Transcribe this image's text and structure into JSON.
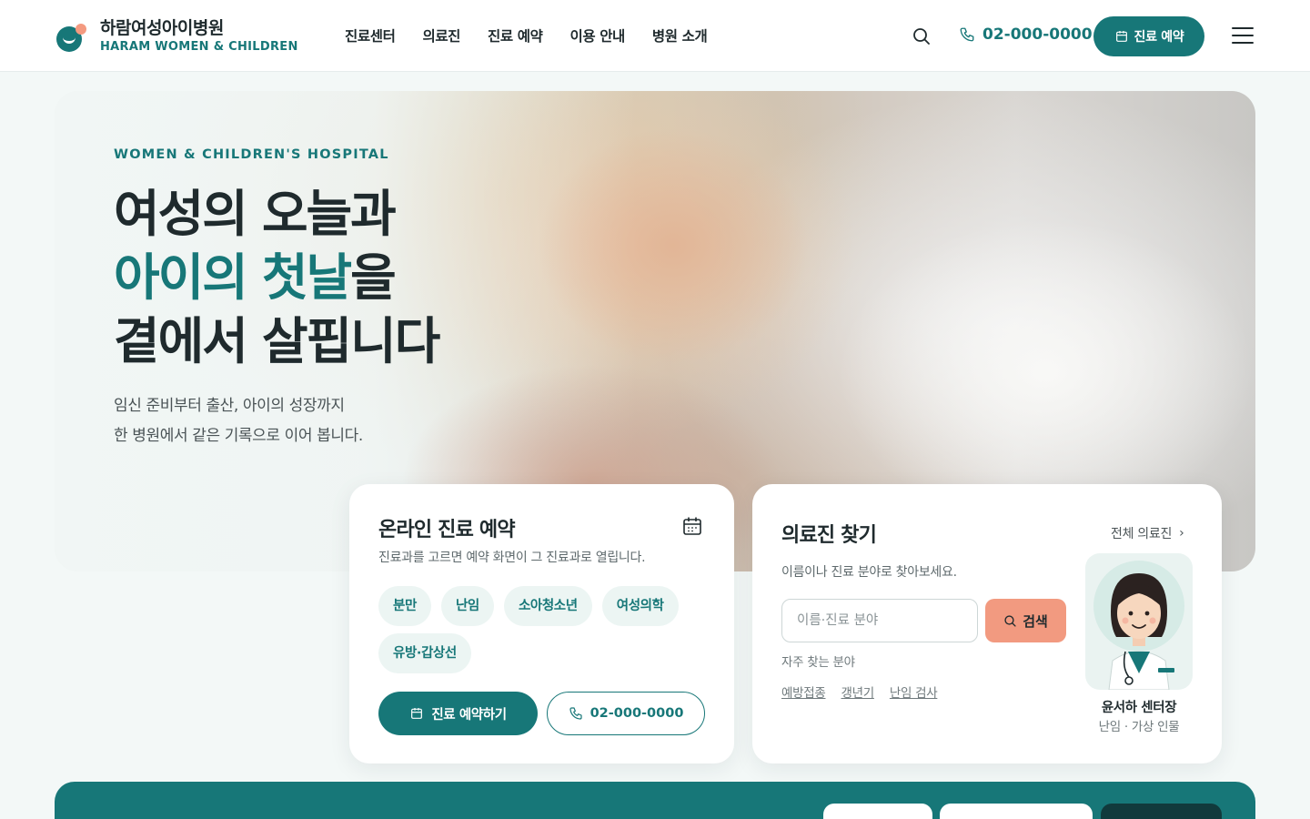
{
  "brand": {
    "name_ko": "하람여성아이병원",
    "name_en": "HARAM WOMEN & CHILDREN",
    "accent": "#177778",
    "coral": "#f29a80"
  },
  "nav": [
    "진료센터",
    "의료진",
    "진료 예약",
    "이용 안내",
    "병원 소개"
  ],
  "header": {
    "phone": "02-000-0000",
    "reserve_label": "진료 예약"
  },
  "hero": {
    "eyebrow": "WOMEN & CHILDREN'S HOSPITAL",
    "title_line1": "여성의 오늘과",
    "title_accent": "아이의 첫날",
    "title_line2_rest": "을",
    "title_line3": "곁에서 살핍니다",
    "sub_line1": "임신 준비부터 출산, 아이의 성장까지",
    "sub_line2": "한 병원에서 같은 기록으로 이어 봅니다."
  },
  "booking": {
    "title": "온라인 진료 예약",
    "desc": "진료과를 고르면 예약 화면이 그 진료과로 열립니다.",
    "departments": [
      "분만",
      "난임",
      "소아청소년",
      "여성의학",
      "유방·갑상선"
    ],
    "primary_label": "진료 예약하기",
    "phone": "02-000-0000"
  },
  "doctor_search": {
    "title": "의료진 찾기",
    "all_link": "전체 의료진",
    "desc": "이름이나 진료 분야로 찾아보세요.",
    "placeholder": "이름·진료 분야",
    "search_label": "검색",
    "frequent_label": "자주 찾는 분야",
    "frequent": [
      "예방접종",
      "갱년기",
      "난임 검사"
    ],
    "doctor_name": "윤서하 센터장",
    "doctor_role": "난임 · 가상 인물"
  }
}
